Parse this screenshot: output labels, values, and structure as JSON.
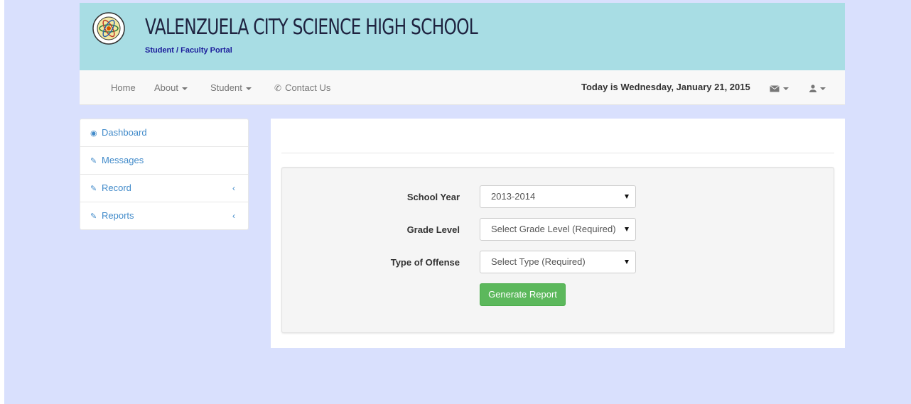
{
  "header": {
    "title": "VALENZUELA CITY SCIENCE HIGH SCHOOL",
    "subtitle": "Student / Faculty Portal",
    "logo_text": "VALENZUELA CITY SCIENCE HIGH SCHOOL 2003"
  },
  "nav": {
    "home": "Home",
    "about": "About",
    "student": "Student",
    "contact": "Contact Us",
    "today": "Today is Wednesday, January 21, 2015",
    "messages_icon": "envelope-icon",
    "user_icon": "user-icon"
  },
  "sidebar": {
    "items": [
      {
        "label": "Dashboard",
        "icon": "dashboard-icon"
      },
      {
        "label": "Messages",
        "icon": "edit-icon"
      },
      {
        "label": "Record",
        "icon": "edit-icon",
        "arrow": "‹"
      },
      {
        "label": "Reports",
        "icon": "edit-icon",
        "arrow": "‹"
      }
    ]
  },
  "form": {
    "school_year_label": "School Year",
    "school_year_value": "2013-2014",
    "grade_level_label": "Grade Level",
    "grade_level_value": "Select Grade Level (Required)",
    "offense_label": "Type of Offense",
    "offense_value": "Select Type (Required)",
    "generate_button": "Generate Report"
  },
  "colors": {
    "page_bg": "#d9e0fd",
    "banner_bg": "#a8dde4",
    "link": "#428bca",
    "success": "#5cb85c"
  }
}
